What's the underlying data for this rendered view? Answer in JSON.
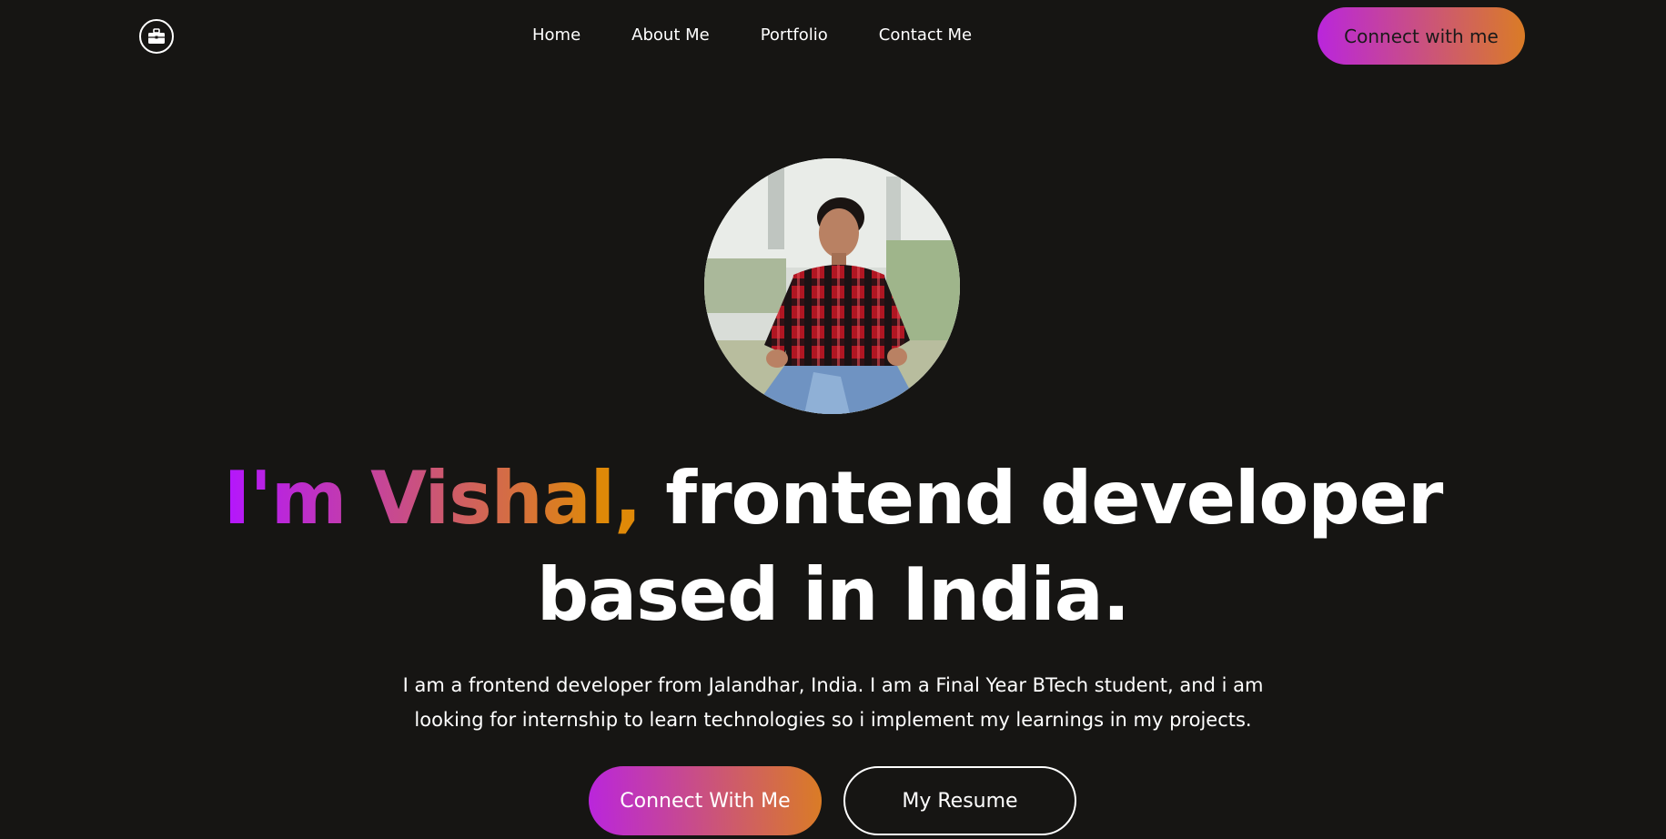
{
  "nav": {
    "logo_icon": "briefcase-icon",
    "items": [
      {
        "label": "Home"
      },
      {
        "label": "About Me"
      },
      {
        "label": "Portfolio"
      },
      {
        "label": "Contact Me"
      }
    ],
    "connect_label": "Connect with me"
  },
  "hero": {
    "headline_highlight": "I'm Vishal,",
    "headline_rest": " frontend developer",
    "headline_line2": "based in India.",
    "intro_line1": "I am a frontend developer from Jalandhar, India. I am a Final Year BTech student, and i am",
    "intro_line2": "looking for internship to learn technologies so i implement my learnings in my projects.",
    "connect_button": "Connect With Me",
    "resume_button": "My Resume"
  },
  "colors": {
    "background": "#161513",
    "gradient_start": "#B923E1",
    "gradient_end": "#DA7C25",
    "text": "#ffffff"
  }
}
